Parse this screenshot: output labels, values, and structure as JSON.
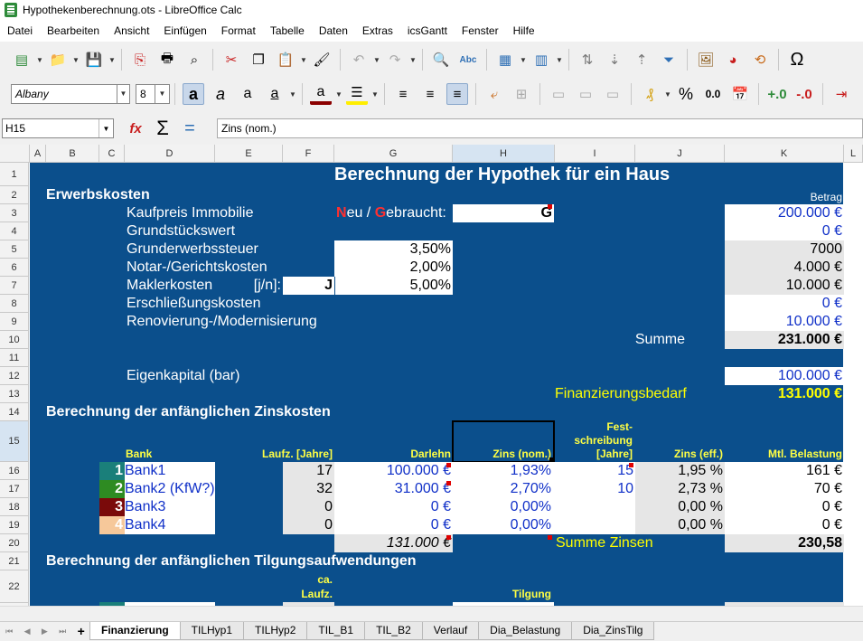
{
  "window": {
    "title": "Hypothekenberechnung.ots - LibreOffice Calc"
  },
  "menu": [
    "Datei",
    "Bearbeiten",
    "Ansicht",
    "Einfügen",
    "Format",
    "Tabelle",
    "Daten",
    "Extras",
    "icsGantt",
    "Fenster",
    "Hilfe"
  ],
  "format": {
    "font": "Albany",
    "size": "8"
  },
  "formula": {
    "cell_ref": "H15",
    "content": "Zins (nom.)"
  },
  "columns": [
    "A",
    "B",
    "C",
    "D",
    "E",
    "F",
    "G",
    "H",
    "I",
    "J",
    "K",
    "L"
  ],
  "rows": [
    "1",
    "2",
    "3",
    "4",
    "5",
    "6",
    "7",
    "8",
    "9",
    "10",
    "11",
    "12",
    "13",
    "14",
    "15",
    "16",
    "17",
    "18",
    "19",
    "20",
    "21",
    "22"
  ],
  "sheet": {
    "title": "Berechnung der Hypothek für ein Haus",
    "erwerb": "Erwerbskosten",
    "betrag": "Betrag",
    "kaufpreis": "Kaufpreis Immobilie",
    "neu_n": "N",
    "neu_rest": "eu / ",
    "geb_g": "G",
    "geb_rest": "ebraucht:",
    "neu_val": "G",
    "grundstueck": "Grundstückswert",
    "grunderwerb": "Grunderwerbssteuer",
    "notar": "Notar-/Gerichtskosten",
    "makler": "Maklerkosten",
    "jn": "[j/n]:",
    "jn_val": "J",
    "erschl": "Erschließungskosten",
    "renov": "Renovierung-/Modernisierung",
    "summe": "Summe",
    "eigen": "Eigenkapital (bar)",
    "finanz": "Finanzierungsbedarf",
    "pct_grund": "3,50%",
    "pct_notar": "2,00%",
    "pct_makler": "5,00%",
    "k3": "200.000 €",
    "k4": "0 €",
    "k5": "7000",
    "k6": "4.000 €",
    "k7": "10.000 €",
    "k8": "0 €",
    "k9": "10.000 €",
    "k10": "231.000 €",
    "k12": "100.000 €",
    "k13": "131.000 €",
    "zins_title": "Berechnung der anfänglichen Zinskosten",
    "hdr_bank": "Bank",
    "hdr_laufz": "Laufz. [Jahre]",
    "hdr_darlehn": "Darlehn",
    "hdr_zins": "Zins (nom.)",
    "hdr_fest1": "Fest-",
    "hdr_fest2": "schreibung",
    "hdr_fest3": "[Jahre]",
    "hdr_eff": "Zins (eff.)",
    "hdr_mtl": "Mtl. Belastung",
    "banks": [
      {
        "n": "1",
        "name": "Bank1",
        "laufz": "17",
        "darl": "100.000 €",
        "zins": "1,93%",
        "fest": "15",
        "eff": "1,95 %",
        "mtl": "161 €",
        "col": "#1a7f7a"
      },
      {
        "n": "2",
        "name": "Bank2 (KfW?)",
        "laufz": "32",
        "darl": "31.000 €",
        "zins": "2,70%",
        "fest": "10",
        "eff": "2,73 %",
        "mtl": "70 €",
        "col": "#2e8b22"
      },
      {
        "n": "3",
        "name": "Bank3",
        "laufz": "0",
        "darl": "0 €",
        "zins": "0,00%",
        "fest": "",
        "eff": "0,00 %",
        "mtl": "0 €",
        "col": "#7a0a0a"
      },
      {
        "n": "4",
        "name": "Bank4",
        "laufz": "0",
        "darl": "0 €",
        "zins": "0,00%",
        "fest": "",
        "eff": "0,00 %",
        "mtl": "0 €",
        "col": "#f6c89a"
      }
    ],
    "darl_sum": "131.000 €",
    "summe_zinsen": "Summe Zinsen",
    "zinsen_val": "230,58",
    "tilg_title": "Berechnung der anfänglichen Tilgungsaufwendungen",
    "ca": "ca.",
    "laufz2": "Laufz.",
    "tilgung": "Tilgung"
  },
  "tabs": [
    "Finanzierung",
    "TILHyp1",
    "TILHyp2",
    "TIL_B1",
    "TIL_B2",
    "Verlauf",
    "Dia_Belastung",
    "Dia_ZinsTilg"
  ]
}
